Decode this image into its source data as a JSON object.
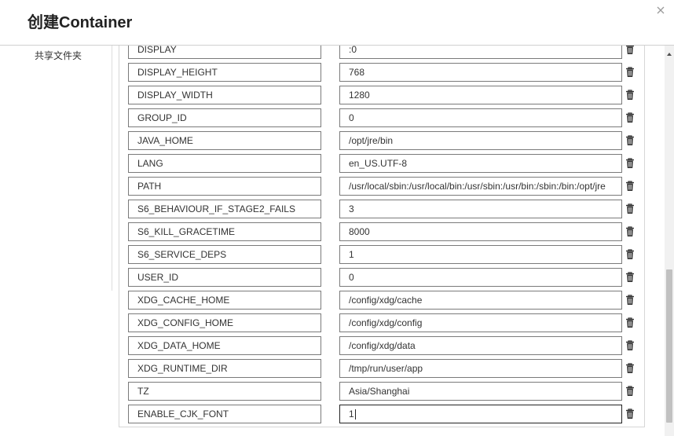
{
  "dialog": {
    "title": "创建Container"
  },
  "sidebar": {
    "items": [
      {
        "label": "共享文件夹"
      }
    ]
  },
  "env_vars": [
    {
      "key": "DISPLAY",
      "value": ":0"
    },
    {
      "key": "DISPLAY_HEIGHT",
      "value": "768"
    },
    {
      "key": "DISPLAY_WIDTH",
      "value": "1280"
    },
    {
      "key": "GROUP_ID",
      "value": "0"
    },
    {
      "key": "JAVA_HOME",
      "value": "/opt/jre/bin"
    },
    {
      "key": "LANG",
      "value": "en_US.UTF-8"
    },
    {
      "key": "PATH",
      "value": "/usr/local/sbin:/usr/local/bin:/usr/sbin:/usr/bin:/sbin:/bin:/opt/jre"
    },
    {
      "key": "S6_BEHAVIOUR_IF_STAGE2_FAILS",
      "value": "3"
    },
    {
      "key": "S6_KILL_GRACETIME",
      "value": "8000"
    },
    {
      "key": "S6_SERVICE_DEPS",
      "value": "1"
    },
    {
      "key": "USER_ID",
      "value": "0"
    },
    {
      "key": "XDG_CACHE_HOME",
      "value": "/config/xdg/cache"
    },
    {
      "key": "XDG_CONFIG_HOME",
      "value": "/config/xdg/config"
    },
    {
      "key": "XDG_DATA_HOME",
      "value": "/config/xdg/data"
    },
    {
      "key": "XDG_RUNTIME_DIR",
      "value": "/tmp/run/user/app"
    },
    {
      "key": "TZ",
      "value": "Asia/Shanghai"
    },
    {
      "key": "ENABLE_CJK_FONT",
      "value": "1"
    }
  ],
  "icons": {
    "close": "close-icon",
    "delete": "trash-icon",
    "scroll_up": "chevron-up-icon"
  },
  "colors": {
    "field_border": "#7a7a7a",
    "header_border": "#cfcfcf",
    "scroll_thumb": "#c1c1c1"
  }
}
